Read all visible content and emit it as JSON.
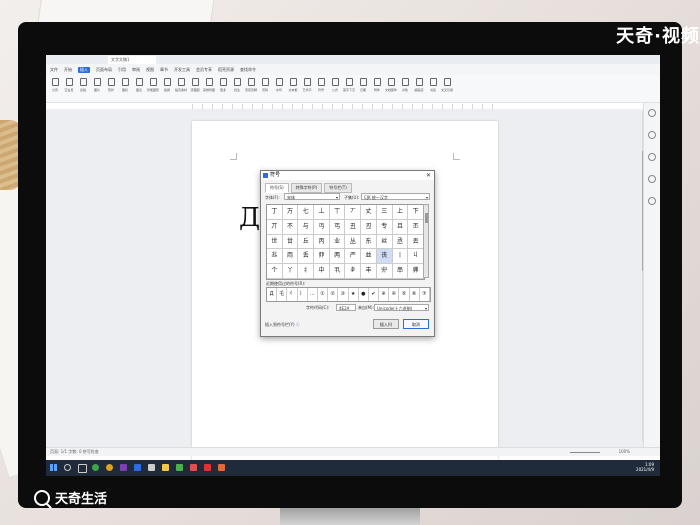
{
  "watermark": {
    "top_right": "天奇·视频",
    "bottom_left": "天奇生活"
  },
  "app": {
    "tab_title": "文字文稿1",
    "menus": [
      "文件",
      "开始",
      "插入",
      "页面布局",
      "引用",
      "审阅",
      "视图",
      "章节",
      "开发工具",
      "会员专享",
      "稻壳资源",
      "查找命令"
    ],
    "active_menu": "插入",
    "ribbon": [
      "分页",
      "空白页",
      "表格",
      "图片",
      "形状",
      "图标",
      "图表",
      "智能图形",
      "截屏",
      "稻壳素材",
      "流程图",
      "思维导图",
      "更多",
      "批注",
      "页眉页脚",
      "页码",
      "水印",
      "文本框",
      "艺术字",
      "符号",
      "公式",
      "首字下沉",
      "日期",
      "附件",
      "文档部件",
      "对象",
      "超链接",
      "书签",
      "交叉引用"
    ],
    "status_left": "页面: 1/1  字数: 0  拼写检查",
    "zoom": "100%",
    "clock_time": "1:09",
    "clock_date": "2021/4/9"
  },
  "dialog": {
    "title": "符号",
    "tabs": [
      "符号(S)",
      "特殊字符(P)",
      "符号栏(T)"
    ],
    "font_label": "字体(F):",
    "font_value": "宋体",
    "subset_label": "子集(U):",
    "subset_value": "CJK 统一汉字",
    "grid": [
      [
        "丁",
        "万",
        "七",
        "丄",
        "丅",
        "丆",
        "丈",
        "三",
        "上",
        "下"
      ],
      [
        "丌",
        "不",
        "与",
        "丏",
        "丐",
        "丑",
        "丒",
        "专",
        "且",
        "丕"
      ],
      [
        "世",
        "丗",
        "丘",
        "丙",
        "业",
        "丛",
        "东",
        "丝",
        "丞",
        "丟"
      ],
      [
        "丠",
        "両",
        "丢",
        "丣",
        "两",
        "严",
        "並",
        "丧",
        "丨",
        "丩"
      ],
      [
        "个",
        "丫",
        "丬",
        "中",
        "丮",
        "丯",
        "丰",
        "丱",
        "串",
        "丳"
      ]
    ],
    "selected_cell": [
      3,
      7
    ],
    "recent_label": "近期使用过的符号(R):",
    "recent": [
      "Д",
      "乇",
      "亻",
      "〕",
      "…",
      "①",
      "②",
      "③",
      "★",
      "●",
      "✔",
      "※",
      "④",
      "⑤",
      "⑥",
      "⑦"
    ],
    "code_label": "字符代码(C):",
    "code_value": "4E2A",
    "from_label": "来自(M):",
    "from_value": "Unicode(十六进制)",
    "shortcut_text": "插入到符号栏(Y)",
    "insert_button": "插入(I)",
    "close_button": "取消"
  },
  "document": {
    "glyph": "Д"
  }
}
